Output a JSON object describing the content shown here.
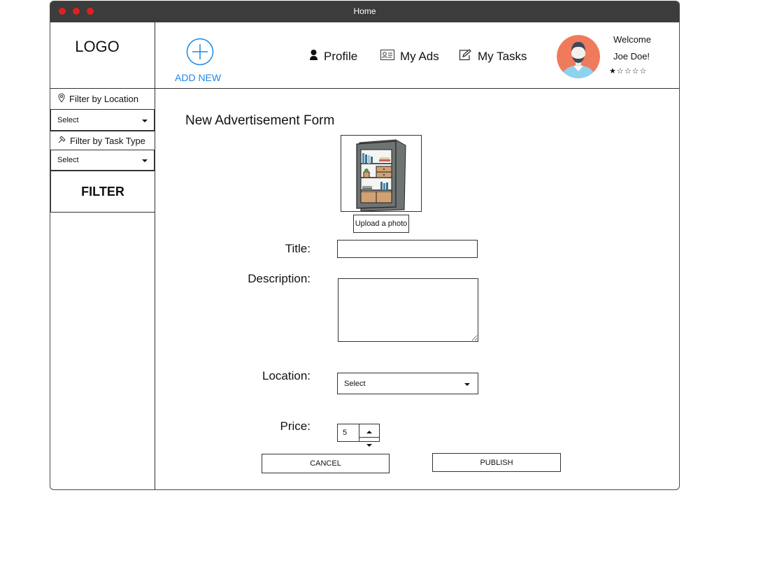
{
  "window": {
    "title": "Home"
  },
  "sidebar": {
    "logo": "LOGO",
    "filter_location_label": "Filter by Location",
    "filter_location_value": "Select",
    "filter_task_label": "Filter by Task Type",
    "filter_task_value": "Select",
    "filter_button": "FILTER"
  },
  "header": {
    "add_new_label": "ADD NEW",
    "nav": [
      {
        "label": "Profile",
        "icon": "person-icon"
      },
      {
        "label": "My Ads",
        "icon": "id-card-icon"
      },
      {
        "label": "My Tasks",
        "icon": "edit-icon"
      }
    ],
    "user": {
      "welcome": "Welcome",
      "name": "Joe Doe!",
      "rating": "★☆☆☆☆"
    }
  },
  "form": {
    "title": "New Advertisement Form",
    "upload_label": "Upload a photo",
    "title_label": "Title:",
    "title_value": "",
    "description_label": "Description:",
    "description_value": "",
    "location_label": "Location:",
    "location_value": "Select",
    "price_label": "Price:",
    "price_value": "5",
    "cancel_label": "CANCEL",
    "publish_label": "PUBLISH"
  },
  "colors": {
    "accent": "#1e88e5",
    "titlebar": "#3c3c3c",
    "window_dots": "#e02020",
    "avatar_bg": "#f07a5c"
  }
}
